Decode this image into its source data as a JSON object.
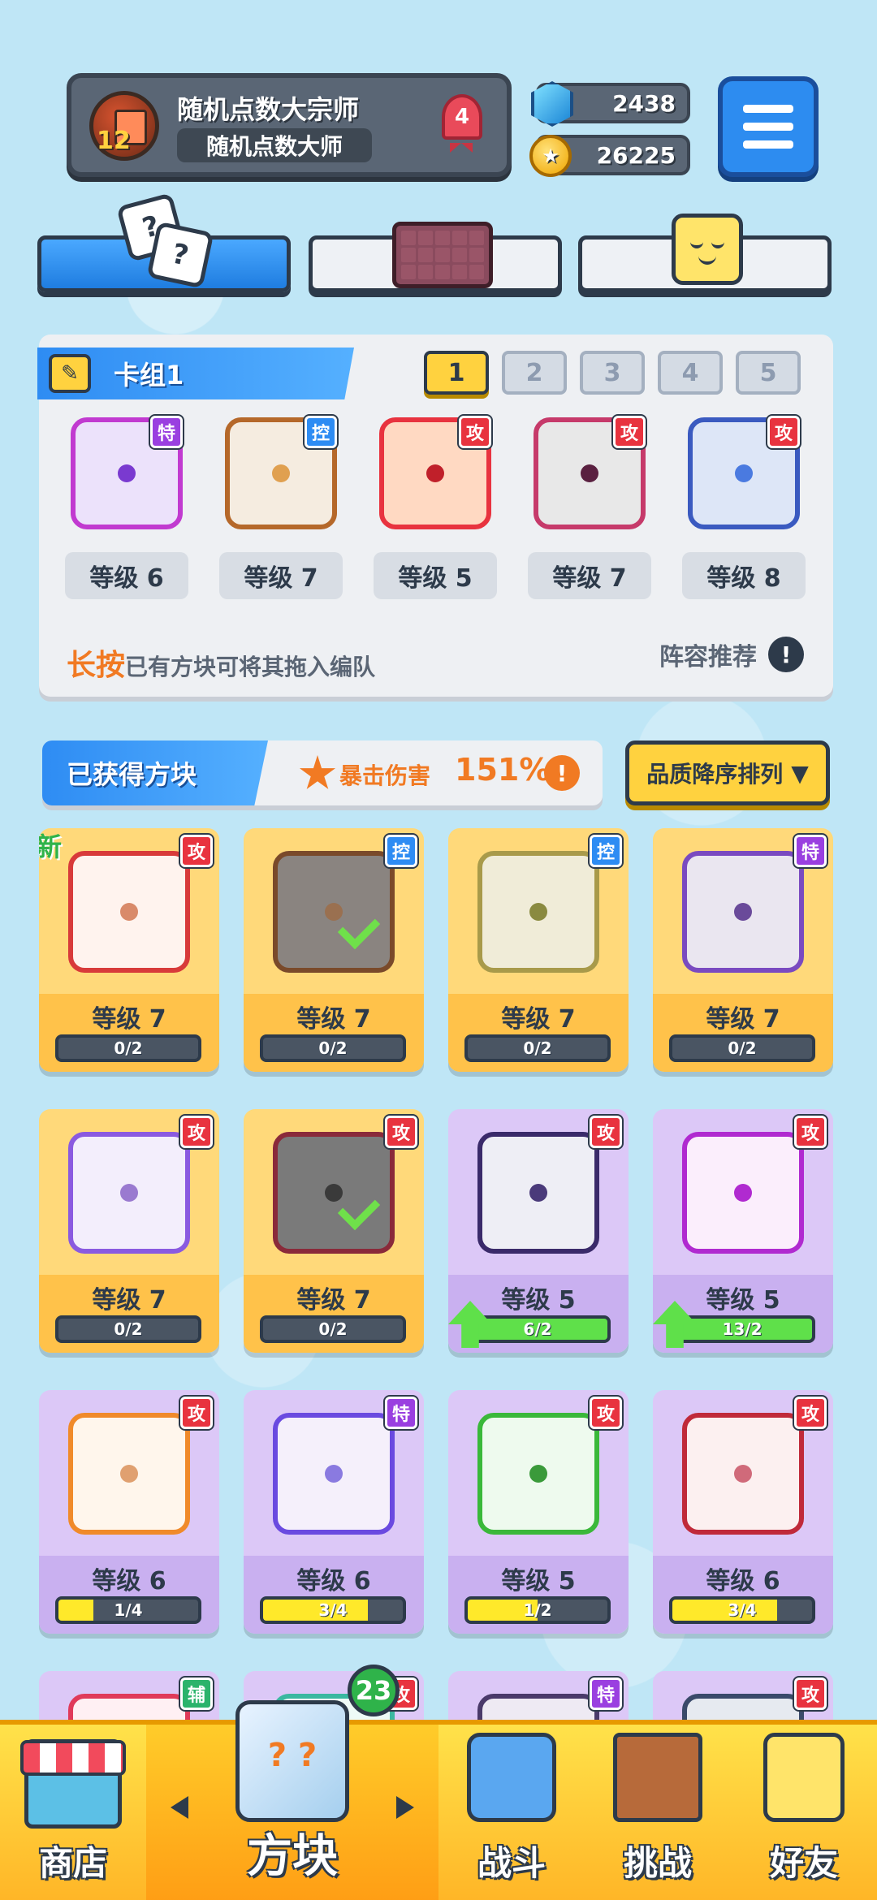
{
  "header": {
    "player_level": "12",
    "player_name": "随机点数大宗师",
    "player_title": "随机点数大师",
    "rank": "4",
    "gems": "2438",
    "coins": "26225"
  },
  "deck": {
    "label": "卡组1",
    "tabs": [
      "1",
      "2",
      "3",
      "4",
      "5"
    ],
    "active_tab": 0,
    "dice": [
      {
        "tag": "特",
        "tag_type": "spc",
        "level": "等级 6",
        "color": "#c13ad0",
        "pip": "#7a3ad0",
        "bg": "#ece2fb"
      },
      {
        "tag": "控",
        "tag_type": "ctl",
        "level": "等级 7",
        "color": "#b5682a",
        "pip": "#e0a050",
        "bg": "#f5ece0"
      },
      {
        "tag": "攻",
        "tag_type": "atk",
        "level": "等级 5",
        "color": "#e8333f",
        "pip": "#c0202a",
        "bg": "#ffd9c2"
      },
      {
        "tag": "攻",
        "tag_type": "atk",
        "level": "等级 7",
        "color": "#c63a6a",
        "pip": "#5a2040",
        "bg": "#e8e8e8"
      },
      {
        "tag": "攻",
        "tag_type": "atk",
        "level": "等级 8",
        "color": "#3a5ac0",
        "pip": "#4a7ae0",
        "bg": "#dde6f7"
      }
    ],
    "hint_emphasis": "长按",
    "hint_rest": "已有方块可将其拖入编队",
    "recommend": "阵容推荐",
    "recommend_icon": "!"
  },
  "obtained": {
    "title": "已获得方块",
    "crit_label": "暴击伤害",
    "crit_value": "151%",
    "crit_icon": "!",
    "sort_label": "品质降序排列",
    "sort_caret": "▼",
    "new_label": "新"
  },
  "cards": [
    {
      "style": "gold",
      "tag": "攻",
      "tag_type": "atk",
      "level": "等级 7",
      "progress": "0/2",
      "fill": 0,
      "fill_color": "yellow",
      "color": "#d83a3a",
      "pip": "#d98a6a",
      "bg": "#fff3ee",
      "new": true,
      "check": false,
      "upgrade": false
    },
    {
      "style": "gold",
      "tag": "控",
      "tag_type": "ctl",
      "level": "等级 7",
      "progress": "0/2",
      "fill": 0,
      "fill_color": "yellow",
      "color": "#7a4a2a",
      "pip": "#9a7050",
      "bg": "#8a8480",
      "new": false,
      "check": true,
      "upgrade": false
    },
    {
      "style": "gold",
      "tag": "控",
      "tag_type": "ctl",
      "level": "等级 7",
      "progress": "0/2",
      "fill": 0,
      "fill_color": "yellow",
      "color": "#a89a4a",
      "pip": "#8a8a40",
      "bg": "#f0ecd8",
      "new": false,
      "check": false,
      "upgrade": false
    },
    {
      "style": "gold",
      "tag": "特",
      "tag_type": "spc",
      "level": "等级 7",
      "progress": "0/2",
      "fill": 0,
      "fill_color": "yellow",
      "color": "#7a4ac0",
      "pip": "#6a4a9a",
      "bg": "#eae6f0",
      "new": false,
      "check": false,
      "upgrade": false
    },
    {
      "style": "gold",
      "tag": "攻",
      "tag_type": "atk",
      "level": "等级 7",
      "progress": "0/2",
      "fill": 0,
      "fill_color": "yellow",
      "color": "#8a5ae0",
      "pip": "#9a7ad0",
      "bg": "#f3eefc",
      "new": false,
      "check": false,
      "upgrade": false
    },
    {
      "style": "gold",
      "tag": "攻",
      "tag_type": "atk",
      "level": "等级 7",
      "progress": "0/2",
      "fill": 0,
      "fill_color": "yellow",
      "color": "#8a2a3a",
      "pip": "#3a3a3a",
      "bg": "#7a7a7a",
      "new": false,
      "check": true,
      "upgrade": false
    },
    {
      "style": "purple",
      "tag": "攻",
      "tag_type": "atk",
      "level": "等级 5",
      "progress": "6/2",
      "fill": 1,
      "fill_color": "green",
      "color": "#3a2a6a",
      "pip": "#4a3a7a",
      "bg": "#eeeef5",
      "new": false,
      "check": false,
      "upgrade": true
    },
    {
      "style": "purple",
      "tag": "攻",
      "tag_type": "atk",
      "level": "等级 5",
      "progress": "13/2",
      "fill": 1,
      "fill_color": "green",
      "color": "#b02ad0",
      "pip": "#b02ad0",
      "bg": "#fbeefc",
      "new": false,
      "check": false,
      "upgrade": true
    },
    {
      "style": "purple",
      "tag": "攻",
      "tag_type": "atk",
      "level": "等级 6",
      "progress": "1/4",
      "fill": 0.25,
      "fill_color": "yellow",
      "color": "#f08a2a",
      "pip": "#e0a070",
      "bg": "#fff6ec",
      "new": false,
      "check": false,
      "upgrade": false
    },
    {
      "style": "purple",
      "tag": "特",
      "tag_type": "spc",
      "level": "等级 6",
      "progress": "3/4",
      "fill": 0.75,
      "fill_color": "yellow",
      "color": "#6a4ae0",
      "pip": "#8a7ae0",
      "bg": "#f5f0fb",
      "new": false,
      "check": false,
      "upgrade": false
    },
    {
      "style": "purple",
      "tag": "攻",
      "tag_type": "atk",
      "level": "等级 5",
      "progress": "1/2",
      "fill": 0.5,
      "fill_color": "yellow",
      "color": "#3ab83a",
      "pip": "#3a9a3a",
      "bg": "#eefaee",
      "new": false,
      "check": false,
      "upgrade": false
    },
    {
      "style": "purple",
      "tag": "攻",
      "tag_type": "atk",
      "level": "等级 6",
      "progress": "3/4",
      "fill": 0.75,
      "fill_color": "yellow",
      "color": "#c02a3a",
      "pip": "#d06a7a",
      "bg": "#fcf0f0",
      "new": false,
      "check": false,
      "upgrade": false
    },
    {
      "style": "purple",
      "tag": "辅",
      "tag_type": "sup",
      "level": "",
      "progress": "",
      "fill": 0,
      "fill_color": "yellow",
      "color": "#e03a5a",
      "pip": "#e03a5a",
      "bg": "#fff0f3",
      "new": false,
      "check": false,
      "upgrade": false
    },
    {
      "style": "purple",
      "tag": "攻",
      "tag_type": "atk",
      "level": "",
      "progress": "",
      "fill": 0,
      "fill_color": "yellow",
      "color": "#3ab8a0",
      "pip": "#3ab8a0",
      "bg": "#eefaf6",
      "new": false,
      "check": false,
      "upgrade": false
    },
    {
      "style": "purple",
      "tag": "特",
      "tag_type": "spc",
      "level": "",
      "progress": "",
      "fill": 0,
      "fill_color": "yellow",
      "color": "#4a3a6a",
      "pip": "#4a3a6a",
      "bg": "#eeeaf3",
      "new": false,
      "check": false,
      "upgrade": false
    },
    {
      "style": "purple",
      "tag": "攻",
      "tag_type": "atk",
      "level": "",
      "progress": "",
      "fill": 0,
      "fill_color": "yellow",
      "color": "#3a4a6a",
      "pip": "#3a4a6a",
      "bg": "#e6eaf0",
      "new": false,
      "check": false,
      "upgrade": false
    }
  ],
  "bottom_nav": {
    "shop": "商店",
    "dice": "方块",
    "dice_badge": "23",
    "battle": "战斗",
    "challenge": "挑战",
    "friends": "好友"
  },
  "icons": {
    "dice_face": "?"
  }
}
